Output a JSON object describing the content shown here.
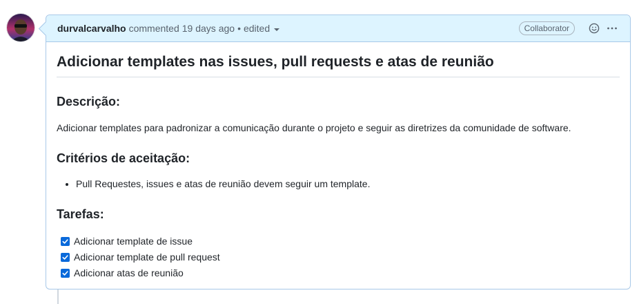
{
  "comment": {
    "author": "durvalcarvalho",
    "action": "commented",
    "time": "19 days ago",
    "separator": "•",
    "edited": "edited",
    "badge": "Collaborator",
    "icons": {
      "reaction": "smiley-icon",
      "more": "kebab-horizontal-icon",
      "edited_menu": "triangle-down-icon"
    }
  },
  "content": {
    "title": "Adicionar templates nas issues, pull requests e atas de reunião",
    "description_heading": "Descrição:",
    "description_text": "Adicionar templates para padronizar a comunicação durante o projeto e seguir as diretrizes da comunidade de software.",
    "criteria_heading": "Critérios de aceitação:",
    "criteria": [
      "Pull Requestes, issues e atas de reunião devem seguir um template."
    ],
    "tasks_heading": "Tarefas:",
    "tasks": [
      {
        "label": "Adicionar template de issue",
        "checked": true
      },
      {
        "label": "Adicionar template de pull request",
        "checked": true
      },
      {
        "label": "Adicionar atas de reunião",
        "checked": true
      }
    ]
  },
  "colors": {
    "header_bg": "#ddf4ff",
    "border": "#a8c8e8",
    "checkbox": "#0969da"
  }
}
